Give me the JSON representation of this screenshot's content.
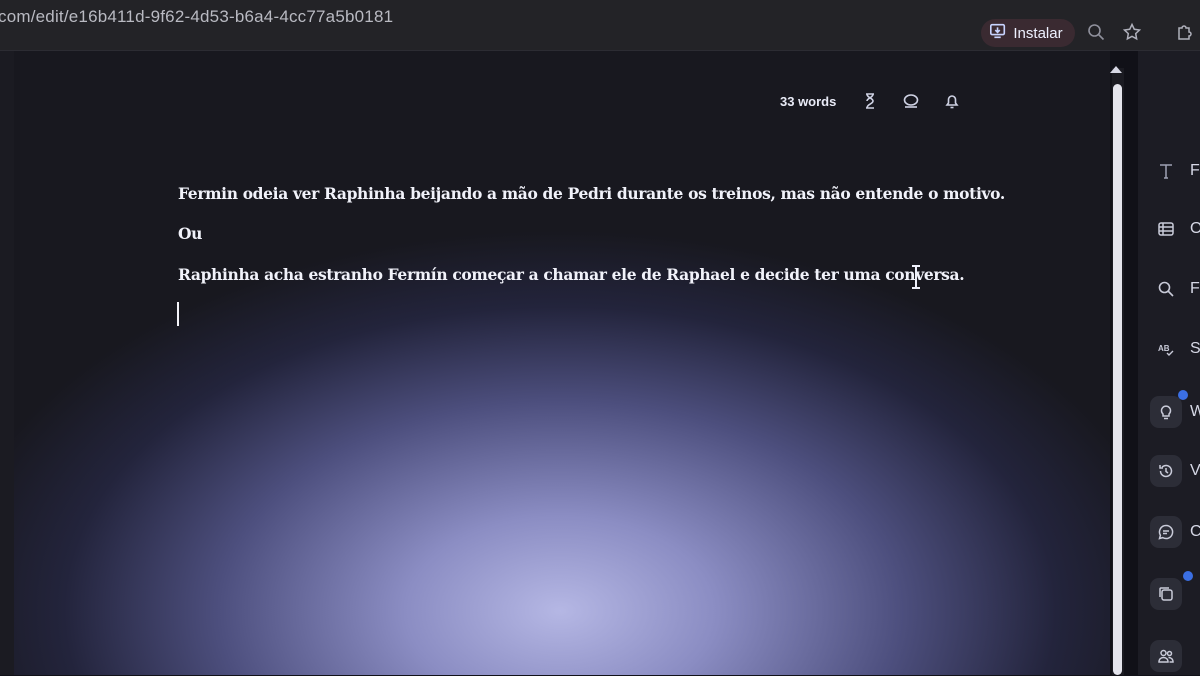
{
  "browser": {
    "url": "com/edit/e16b411d-9f62-4d53-b6a4-4cc77a5b0181",
    "install_label": "Instalar",
    "icons": [
      "install-icon",
      "zoom-icon",
      "star-icon",
      "extensions-icon"
    ]
  },
  "editor": {
    "word_count": "33 words",
    "toolbar_icons": [
      "hourglass-icon",
      "focus-icon",
      "bell-icon"
    ],
    "paragraphs": [
      "Fermin odeia ver Raphinha beijando a mão de Pedri durante os treinos, mas não entende o motivo.",
      "Ou",
      "Raphinha acha estranho Fermín começar a chamar ele de Raphael e decide ter uma conversa."
    ]
  },
  "side_panel": {
    "items": [
      {
        "label": "Fo",
        "icon": "font-icon"
      },
      {
        "label": "Ou",
        "icon": "outline-icon"
      },
      {
        "label": "Fi",
        "icon": "find-icon"
      },
      {
        "label": "S",
        "icon": "spellcheck-icon"
      },
      {
        "label": "W",
        "icon": "lightbulb-icon"
      },
      {
        "label": "V",
        "icon": "history-icon"
      },
      {
        "label": "C",
        "icon": "comment-icon"
      },
      {
        "label": "",
        "icon": "copy-icon"
      },
      {
        "label": "",
        "icon": "people-icon"
      }
    ]
  },
  "colors": {
    "topbar": "#232327",
    "install_button": "#3a2a31",
    "text": "#f1f2fa",
    "accent_badge": "#3b6fe3"
  }
}
